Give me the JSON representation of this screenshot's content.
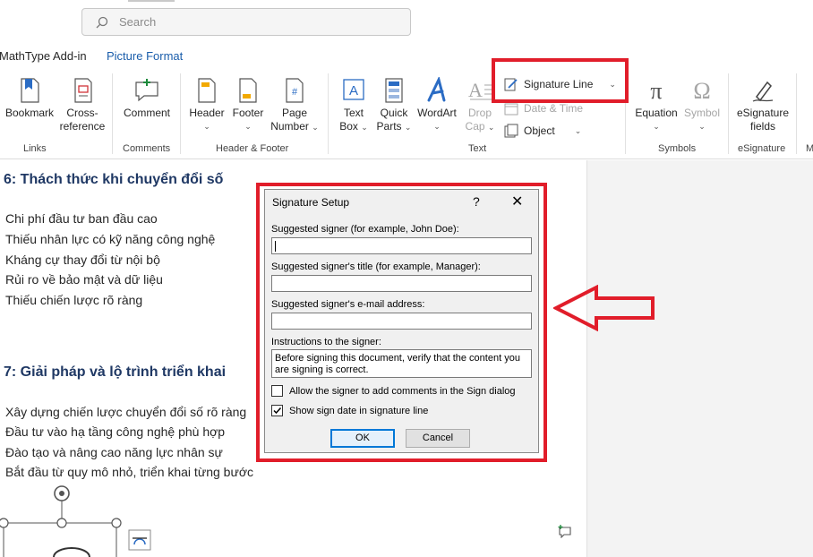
{
  "search": {
    "placeholder": "Search"
  },
  "tabs": [
    {
      "label": "MathType Add-in",
      "active": false
    },
    {
      "label": "Picture Format",
      "active": true
    }
  ],
  "ribbon": {
    "links": {
      "bookmark": "Bookmark",
      "cross_ref_1": "Cross-",
      "cross_ref_2": "reference",
      "group": "Links"
    },
    "comments": {
      "comment": "Comment",
      "group": "Comments"
    },
    "header_footer": {
      "header": "Header",
      "footer": "Footer",
      "page_number_1": "Page",
      "page_number_2": "Number",
      "group": "Header & Footer"
    },
    "text": {
      "text_box_1": "Text",
      "text_box_2": "Box",
      "quick_parts_1": "Quick",
      "quick_parts_2": "Parts",
      "wordart": "WordArt",
      "drop_cap_1": "Drop",
      "drop_cap_2": "Cap",
      "signature_line": "Signature Line",
      "date_time": "Date & Time",
      "object": "Object",
      "group": "Text"
    },
    "symbols": {
      "equation": "Equation",
      "symbol": "Symbol",
      "group": "Symbols"
    },
    "esignature": {
      "fields_1": "eSignature",
      "fields_2": "fields",
      "group": "eSignature",
      "partial": "M"
    }
  },
  "document": {
    "heading_1": "6: Thách thức khi chuyển đổi số",
    "list_1": [
      "Chi phí đầu tư ban đầu cao",
      "Thiếu nhân lực có kỹ năng công nghệ",
      "Kháng cự thay đổi từ nội bộ",
      "Rủi ro về bảo mật và dữ liệu",
      "Thiếu chiến lược rõ ràng"
    ],
    "heading_2": "7: Giải pháp và lộ trình triển khai",
    "list_2": [
      "Xây dựng chiến lược chuyển đổi số rõ ràng",
      "Đầu tư vào hạ tầng công nghệ phù hợp",
      "Đào tạo và nâng cao năng lực nhân sự",
      "Bắt đầu từ quy mô nhỏ, triển khai từng bước"
    ]
  },
  "dialog": {
    "title": "Signature Setup",
    "help": "?",
    "close": "✕",
    "signer_label": "Suggested signer (for example, John Doe):",
    "signer_value": "",
    "title_label": "Suggested signer's title (for example, Manager):",
    "title_value": "",
    "email_label": "Suggested signer's e-mail address:",
    "email_value": "",
    "instructions_label": "Instructions to the signer:",
    "instructions_value": "Before signing this document, verify that the content you are signing is correct.",
    "allow_comments_label": "Allow the signer to add comments in the Sign dialog",
    "allow_comments_checked": false,
    "show_date_label": "Show sign date in signature line",
    "show_date_checked": true,
    "ok": "OK",
    "cancel": "Cancel"
  },
  "colors": {
    "highlight": "#e11d2a",
    "accent": "#1a5dab",
    "heading": "#1f3864"
  }
}
